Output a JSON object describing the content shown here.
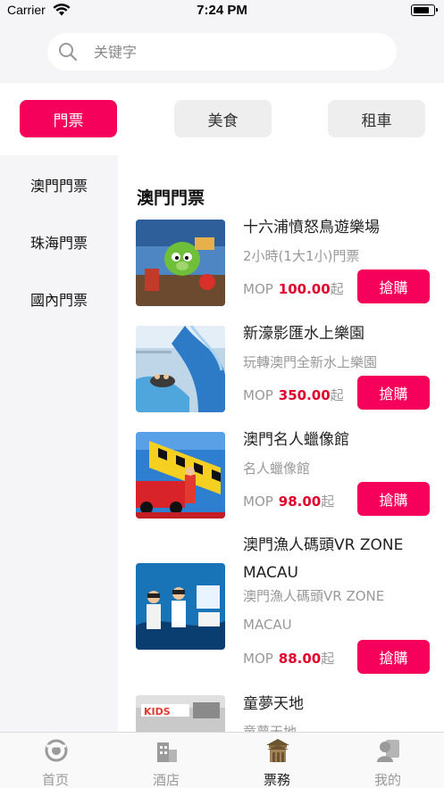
{
  "status_bar": {
    "carrier": "Carrier",
    "time": "7:24 PM"
  },
  "search": {
    "placeholder": "关键字",
    "value": ""
  },
  "category_tabs": [
    {
      "label": "門票",
      "active": true
    },
    {
      "label": "美食",
      "active": false
    },
    {
      "label": "租車",
      "active": false
    }
  ],
  "sidebar": {
    "items": [
      {
        "label": "澳門門票"
      },
      {
        "label": "珠海門票"
      },
      {
        "label": "國內門票"
      }
    ]
  },
  "main": {
    "section_title": "澳門門票",
    "items": [
      {
        "title": "十六浦憤怒鳥遊樂場",
        "subtitle": "2小時(1大1小)門票",
        "currency": "MOP",
        "price": "100.00",
        "suffix": "起",
        "button": "搶購"
      },
      {
        "title": "新濠影匯水上樂園",
        "subtitle": "玩轉澳門全新水上樂園",
        "currency": "MOP",
        "price": "350.00",
        "suffix": "起",
        "button": "搶購"
      },
      {
        "title": "澳門名人蠟像館",
        "subtitle": "名人蠟像館",
        "currency": "MOP",
        "price": "98.00",
        "suffix": "起",
        "button": "搶購"
      },
      {
        "title": "澳門漁人碼頭VR ZONE MACAU",
        "subtitle": "澳門漁人碼頭VR ZONE MACAU",
        "currency": "MOP",
        "price": "88.00",
        "suffix": "起",
        "button": "搶購"
      },
      {
        "title": "童夢天地",
        "subtitle": "童夢天地",
        "thumb_text": "KIDS"
      }
    ]
  },
  "tabbar": {
    "items": [
      {
        "label": "首页",
        "icon": "home-eye-icon",
        "active": false
      },
      {
        "label": "酒店",
        "icon": "hotel-building-icon",
        "active": false
      },
      {
        "label": "票務",
        "icon": "ticket-temple-icon",
        "active": true
      },
      {
        "label": "我的",
        "icon": "profile-icon",
        "active": false
      }
    ]
  },
  "colors": {
    "accent": "#f5005b",
    "price": "#e0002a",
    "muted": "#999999",
    "sidebar_bg": "#f5f5f7"
  }
}
